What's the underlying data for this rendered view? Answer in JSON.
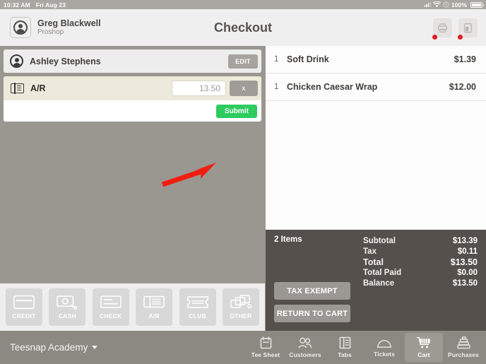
{
  "statusbar": {
    "time": "10:32 AM",
    "date": "Fri Aug 23",
    "battery_percent": "100%",
    "signal_icon": "signal-bars-icon",
    "wifi_icon": "wifi-icon",
    "location_icon": "location-services-icon",
    "battery_icon": "battery-full-icon"
  },
  "header": {
    "user_name": "Greg Blackwell",
    "user_role": "Proshop",
    "title": "Checkout",
    "avatar_icon": "user-avatar-icon",
    "printer_icon": "printer-icon",
    "card_reader_icon": "card-reader-icon",
    "printer_status": "offline",
    "card_reader_status": "offline"
  },
  "checkout": {
    "customer": {
      "name": "Ashley Stephens",
      "avatar_icon": "customer-avatar-icon",
      "edit_label": "EDIT"
    },
    "payment_line": {
      "icon": "ar-ticket-icon",
      "label": "A/R",
      "amount_value": "13.50",
      "amount_placeholder": "0.00",
      "remove_label": "x"
    },
    "submit_label": "Submit",
    "annotation": {
      "type": "arrow",
      "color": "#f01e10",
      "points_at": "submit-button"
    }
  },
  "payment_methods": [
    {
      "label": "CREDIT",
      "icon": "credit-card-icon"
    },
    {
      "label": "CASH",
      "icon": "cash-icon"
    },
    {
      "label": "CHECK",
      "icon": "check-icon"
    },
    {
      "label": "A/R",
      "icon": "ar-ticket-icon"
    },
    {
      "label": "CLUB",
      "icon": "club-ticket-icon"
    },
    {
      "label": "OTHER",
      "icon": "other-payment-icon"
    }
  ],
  "cart": {
    "items": [
      {
        "qty": "1",
        "name": "Soft Drink",
        "price": "$1.39"
      },
      {
        "qty": "1",
        "name": "Chicken Caesar Wrap",
        "price": "$12.00"
      }
    ],
    "items_count_label": "2 Items",
    "tax_exempt_label": "TAX EXEMPT",
    "return_to_cart_label": "RETURN TO CART",
    "totals": [
      {
        "label": "Subtotal",
        "value": "$13.39",
        "emphasis": false
      },
      {
        "label": "Tax",
        "value": "$0.11",
        "emphasis": false
      },
      {
        "label": "Total",
        "value": "$13.50",
        "emphasis": true
      },
      {
        "label": "Total Paid",
        "value": "$0.00",
        "emphasis": false
      },
      {
        "label": "Balance",
        "value": "$13.50",
        "emphasis": false
      }
    ]
  },
  "bottom_nav": {
    "brand": "Teesnap Academy",
    "items": [
      {
        "label": "Tee Sheet",
        "icon": "tee-sheet-icon",
        "active": false
      },
      {
        "label": "Customers",
        "icon": "customers-icon",
        "active": false
      },
      {
        "label": "Tabs",
        "icon": "tabs-icon",
        "active": false
      },
      {
        "label": "Tickets",
        "icon": "tickets-icon",
        "active": false
      },
      {
        "label": "Cart",
        "icon": "shopping-cart-icon",
        "active": true
      },
      {
        "label": "Purchases",
        "icon": "register-icon",
        "active": false
      }
    ]
  },
  "colors": {
    "accent_green": "#2ecc5f",
    "annotation_red": "#f01e10",
    "status_dot_red": "#e02020",
    "totals_bg": "#55504c",
    "app_bg": "#9a9791",
    "highlight_row": "#eeeadb"
  }
}
